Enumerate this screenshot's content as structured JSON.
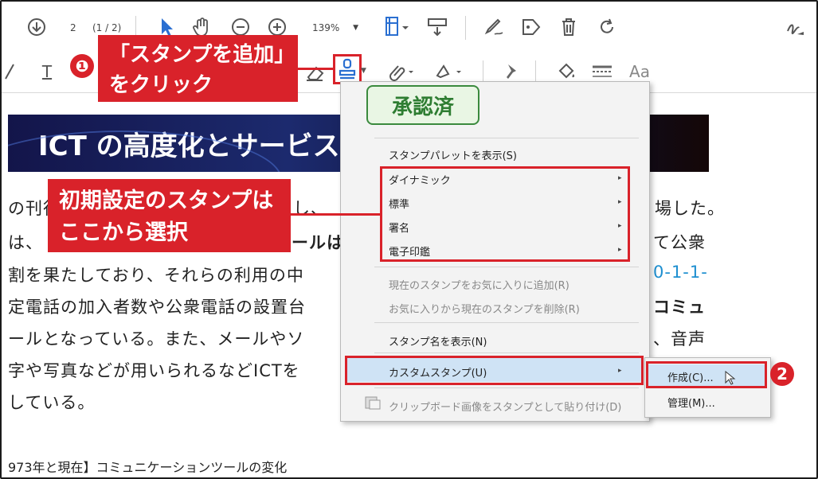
{
  "toolbar1": {
    "page_current": "2",
    "page_total": "(1 / 2)",
    "zoom": "139%"
  },
  "toolbar2": {
    "text_label": "T",
    "aa_label": "Aa"
  },
  "callouts": {
    "c1_line1": "「スタンプを追加」",
    "c1_line2": "をクリック",
    "c2_line1": "初期設定のスタンプは",
    "c2_line2": "ここから選択",
    "num1": "❶",
    "num2": "2"
  },
  "document": {
    "banner_title": "ICT の高度化とサービス",
    "lines": [
      "の刊行",
      "は、",
      "割を果たしており、それらの利用の中",
      "定電話の加入者数や公衆電話の設置台",
      "ールとなっている。また、メールやソ",
      "字や写真などが用いられるなどICTを",
      "している。"
    ],
    "line1_mid": "し、",
    "line1_tail": "場した。",
    "line2_bold": "ールは",
    "line2_tail": "て公衆",
    "line3_tail": "0-1-1-",
    "line4_tail": "コミュ",
    "line5_tail": "、音声",
    "caption": "973年と現在】コミュニケーションツールの変化"
  },
  "menu": {
    "stamp_preview": "承認済",
    "items": [
      "スタンプパレットを表示(S)",
      "ダイナミック",
      "標準",
      "署名",
      "電子印鑑",
      "現在のスタンプをお気に入りに追加(R)",
      "お気に入りから現在のスタンプを削除(R)",
      "スタンプ名を表示(N)",
      "カスタムスタンプ(U)",
      "クリップボード画像をスタンプとして貼り付け(D)"
    ],
    "arrow": "▸"
  },
  "submenu": {
    "items": [
      "作成(C)...",
      "管理(M)..."
    ]
  },
  "colors": {
    "accent_red": "#d9222a",
    "highlight": "#cfe3f5",
    "stamp_green": "#2e7d32"
  }
}
